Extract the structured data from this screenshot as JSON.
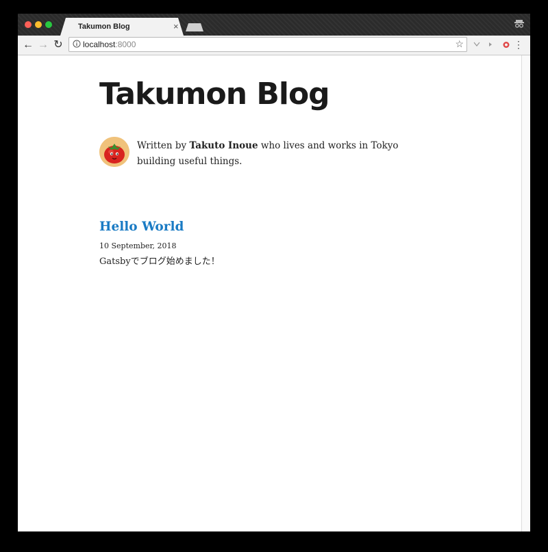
{
  "browser": {
    "tab_title": "Takumon Blog",
    "tab_close": "×",
    "url_host": "localhost",
    "url_port": ":8000"
  },
  "site": {
    "title": "Takumon Blog"
  },
  "bio": {
    "prefix": "Written by ",
    "author": "Takuto Inoue",
    "suffix": " who lives and works in Tokyo building useful things."
  },
  "posts": [
    {
      "title": "Hello World",
      "date": "10 September, 2018",
      "excerpt": "Gatsbyでブログ始めました！"
    }
  ]
}
